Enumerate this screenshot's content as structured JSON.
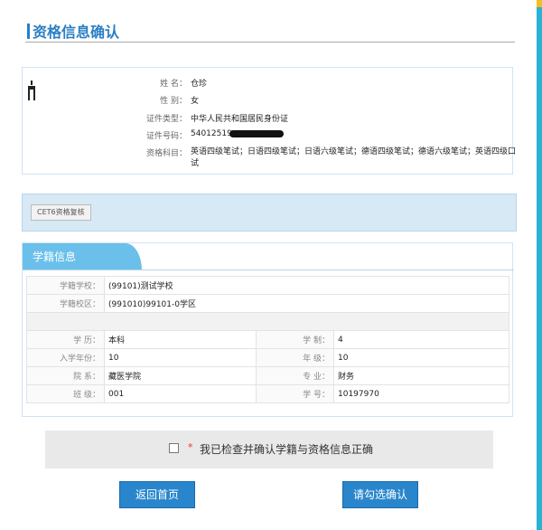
{
  "page": {
    "title": "资格信息确认",
    "accent_color": "#2b7fc3"
  },
  "person": {
    "photo_icon": "avatar-silhouette-icon",
    "name_label": "姓    名：",
    "name": "仓珍",
    "gender_label": "性    别：",
    "gender": "女",
    "id_type_label": "证件类型：",
    "id_type": "中华人民共和国居民身份证",
    "id_number_label": "证件号码：",
    "id_number_prefix": "54012519",
    "subjects_label": "资格科目：",
    "subjects": "英语四级笔试；日语四级笔试；日语六级笔试；德语四级笔试；德语六级笔试；英语四级口试"
  },
  "actions": {
    "cet_review_button": "CET6资格复核"
  },
  "school": {
    "section_title": "学籍信息",
    "school_label": "学籍学校：",
    "school_value": "(99101)测试学校",
    "campus_label": "学籍校区：",
    "campus_value": "(991010)99101-0学区",
    "education_label": "学    历：",
    "education_value": "本科",
    "system_label": "学    制：",
    "system_value": "4",
    "enroll_year_label": "入学年份：",
    "enroll_year_value": "10",
    "grade_label": "年    级：",
    "grade_value": "10",
    "dept_label": "院    系：",
    "dept_value": "藏医学院",
    "major_label": "专    业：",
    "major_value": "财务",
    "class_label": "班    级：",
    "class_value": "001",
    "student_no_label": "学    号：",
    "student_no_value": "10197970"
  },
  "confirm": {
    "required_mark": "*",
    "text": "我已检查并确认学籍与资格信息正确"
  },
  "buttons": {
    "home": "返回首页",
    "confirm": "请勾选确认"
  }
}
